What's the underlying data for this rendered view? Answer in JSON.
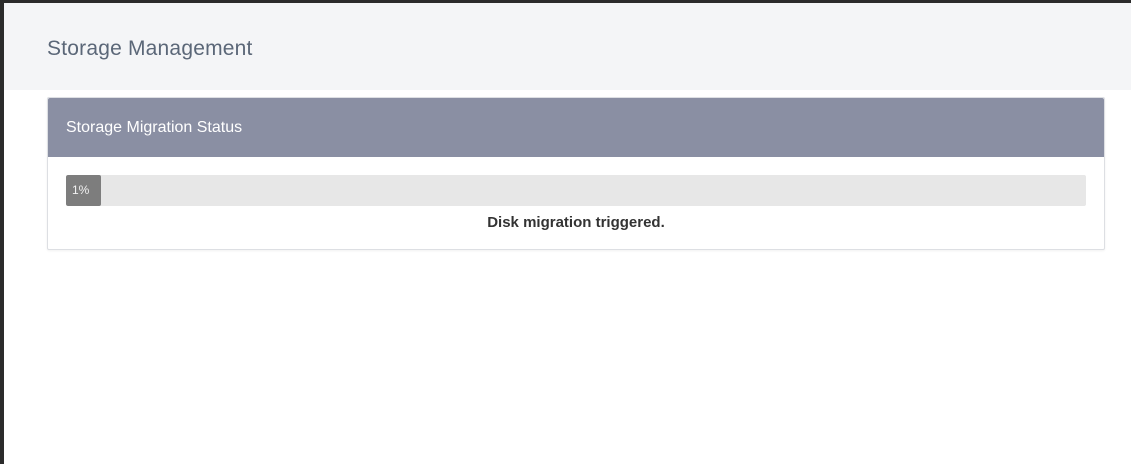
{
  "header": {
    "title": "Storage Management"
  },
  "panel": {
    "title": "Storage Migration Status",
    "progress": {
      "percent": 1,
      "label": "1%"
    },
    "status_message": "Disk migration triggered."
  },
  "colors": {
    "header_bg": "#f4f5f7",
    "panel_heading_bg": "#8a8fa3",
    "progress_track": "#e7e7e7",
    "progress_fill": "#7d7d7d"
  }
}
